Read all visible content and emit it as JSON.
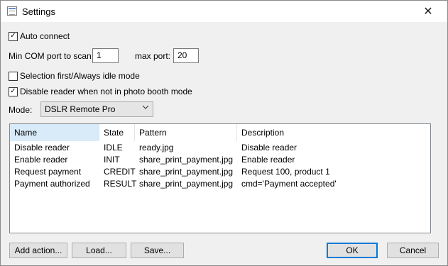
{
  "window": {
    "title": "Settings",
    "close_glyph": "✕"
  },
  "auto_connect": {
    "label": "Auto connect",
    "checked": true
  },
  "com": {
    "min_label": "Min COM port to scan:",
    "min_value": "1",
    "max_label": "max port:",
    "max_value": "20"
  },
  "selection_first": {
    "label": "Selection first/Always idle mode",
    "checked": false
  },
  "disable_reader": {
    "label": "Disable reader when not in photo booth mode",
    "checked": true
  },
  "mode": {
    "label": "Mode:",
    "value": "DSLR Remote Pro"
  },
  "table": {
    "headers": [
      "Name",
      "State",
      "Pattern",
      "Description"
    ],
    "rows": [
      [
        "Disable reader",
        "IDLE",
        "ready.jpg",
        "Disable reader"
      ],
      [
        "Enable reader",
        "INIT",
        "share_print_payment.jpg",
        "Enable reader"
      ],
      [
        "Request payment",
        "CREDIT",
        "share_print_payment.jpg",
        "Request 100, product 1"
      ],
      [
        "Payment authorized",
        "RESULT",
        "share_print_payment.jpg",
        "cmd='Payment accepted'"
      ]
    ]
  },
  "buttons": {
    "add_action": "Add action...",
    "load": "Load...",
    "save": "Save...",
    "ok": "OK",
    "cancel": "Cancel"
  },
  "icons": {
    "check": "✓",
    "app": "settings-window-icon"
  }
}
